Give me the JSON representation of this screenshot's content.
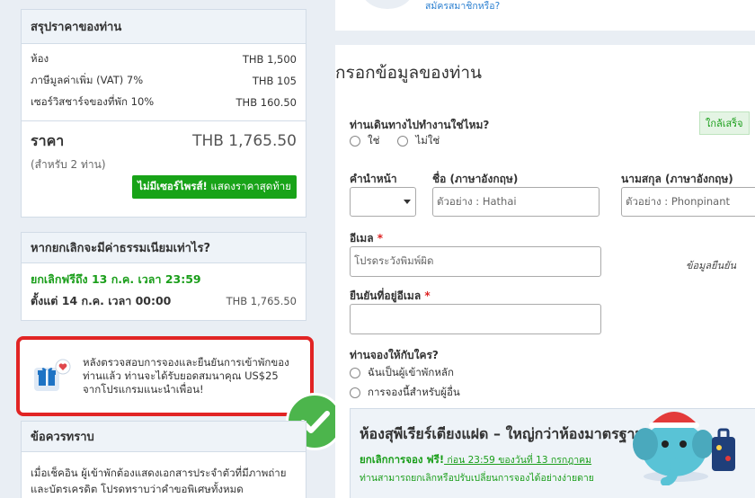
{
  "price": {
    "title": "สรุปราคาของท่าน",
    "lines": [
      {
        "label": "ห้อง",
        "value": "THB 1,500"
      },
      {
        "label": "ภาษีมูลค่าเพิ่ม (VAT) 7%",
        "value": "THB 105"
      },
      {
        "label": "เซอร์วิสชาร์จของที่พัก 10%",
        "value": "THB 160.50"
      }
    ],
    "total_label": "ราคา",
    "total_value": "THB 1,765.50",
    "total_sub": "(สำหรับ 2 ท่าน)",
    "badge_bold": "ไม่มีเซอร์ไพรส์!",
    "badge_text": " แสดงราคาสุดท้าย"
  },
  "cancel": {
    "title": "หากยกเลิกจะมีค่าธรรมเนียมเท่าไร?",
    "free_until": "ยกเลิกฟรีถึง 13 ก.ค. เวลา 23:59",
    "from_label": "ตั้งแต่ 14 ก.ค. เวลา 00:00",
    "from_fee": "THB 1,765.50"
  },
  "promo": {
    "text": "หลังตรวจสอบการจองและยืนยันการเข้าพักของท่านแล้ว ท่านจะได้รับยอดสมนาคุณ US$25 จากโปรแกรมแนะนำเพื่อน!"
  },
  "notes": {
    "title": "ข้อควรทราบ",
    "text": "เมื่อเช็คอิน ผู้เข้าพักต้องแสดงเอกสารประจำตัวที่มีภาพถ่ายและบัตรเครดิต โปรดทราบว่าคำขอพิเศษทั้งหมด"
  },
  "top": {
    "member_link": "สมัครสมาชิกหรือ?"
  },
  "form": {
    "title": "กรอกข้อมูลของท่าน",
    "near_finish": "ใกล้เสร็จ",
    "business_q": "ท่านเดินทางไปทำงานใช่ไหม?",
    "yes": "ใช่",
    "no": "ไม่ใช่",
    "prefix_label": "คำนำหน้า",
    "first_label": "ชื่อ (ภาษาอังกฤษ)",
    "first_placeholder": "ตัวอย่าง : Hathai",
    "last_label": "นามสกุล (ภาษาอังกฤษ)",
    "last_placeholder": "ตัวอย่าง : Phonpinant",
    "email_label": "อีเมล",
    "email_placeholder": "โปรดระวังพิมพ์ผิด",
    "email_confirm_label": "ยืนยันที่อยู่อีเมล",
    "hint_right": "ข้อมูลยืนยัน",
    "booking_for_q": "ท่านจองให้กับใคร?",
    "opt_main": "ฉันเป็นผู้เข้าพักหลัก",
    "opt_other": "การจองนี้สำหรับผู้อื่น",
    "required_mark": "*"
  },
  "room": {
    "title": "ห้องสุพีเรียร์เตียงแฝด – ใหญ่กว่าห้องมาตรฐาน",
    "free_cancel": "ยกเลิกการจอง ฟรี!",
    "free_detail": " ก่อน 23:59 ของวันที่ 13 กรกฎาคม",
    "note": "ท่านสามารถยกเลิกหรือปรับเปลี่ยนการจองได้อย่างง่ายดาย"
  },
  "colors": {
    "accent_green": "#18a318",
    "promo_border": "#e12424",
    "link_blue": "#2a7fd0"
  }
}
